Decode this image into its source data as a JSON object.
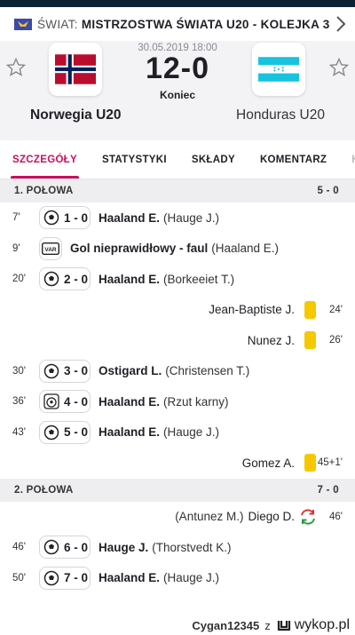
{
  "league": {
    "country": "ŚWIAT:",
    "competition": "MISTRZOSTWA ŚWIATA U20 - KOLEJKA 3"
  },
  "match": {
    "datetime": "30.05.2019 18:00",
    "score": "12-0",
    "status": "Koniec",
    "home": "Norwegia U20",
    "away": "Honduras U20"
  },
  "tabs": [
    "SZCZEGÓŁY",
    "STATYSTYKI",
    "SKŁADY",
    "KOMENTARZ",
    "K"
  ],
  "first_half": {
    "label": "1. POŁOWA",
    "score": "5 - 0",
    "events": [
      {
        "minute": "7'",
        "score": "1 - 0",
        "player": "Haaland E.",
        "assist": "(Hauge J.)"
      },
      {
        "minute": "9'",
        "var": "Gol nieprawidłowy - faul",
        "assist": "(Haaland E.)"
      },
      {
        "minute": "20'",
        "score": "2 - 0",
        "player": "Haaland E.",
        "assist": "(Borkeeiet T.)"
      },
      {
        "minute": "24'",
        "card_player": "Jean-Baptiste J."
      },
      {
        "minute": "26'",
        "card_player": "Nunez J."
      },
      {
        "minute": "30'",
        "score": "3 - 0",
        "player": "Ostigard L.",
        "assist": "(Christensen T.)"
      },
      {
        "minute": "36'",
        "score": "4 - 0",
        "player": "Haaland E.",
        "assist": "(Rzut karny)"
      },
      {
        "minute": "43'",
        "score": "5 - 0",
        "player": "Haaland E.",
        "assist": "(Hauge J.)"
      },
      {
        "minute": "45+1'",
        "card_player": "Gomez A."
      }
    ]
  },
  "second_half": {
    "label": "2. POŁOWA",
    "score": "7 - 0",
    "events": [
      {
        "minute": "46'",
        "sub_out": "(Antunez M.)",
        "sub_in": "Diego D."
      },
      {
        "minute": "46'",
        "score": "6 - 0",
        "player": "Hauge J.",
        "assist": "(Thorstvedt K.)"
      },
      {
        "minute": "50'",
        "score": "7 - 0",
        "player": "Haaland E.",
        "assist": "(Hauge J.)"
      }
    ]
  },
  "watermark": {
    "user": "Cygan12345",
    "sep": "z",
    "site": "wykop.pl"
  },
  "colors": {
    "accent": "#c8105e",
    "card": "#f6c800",
    "norway_red": "#ba0c2f",
    "norway_blue": "#00205b",
    "honduras_blue": "#18c3df"
  }
}
